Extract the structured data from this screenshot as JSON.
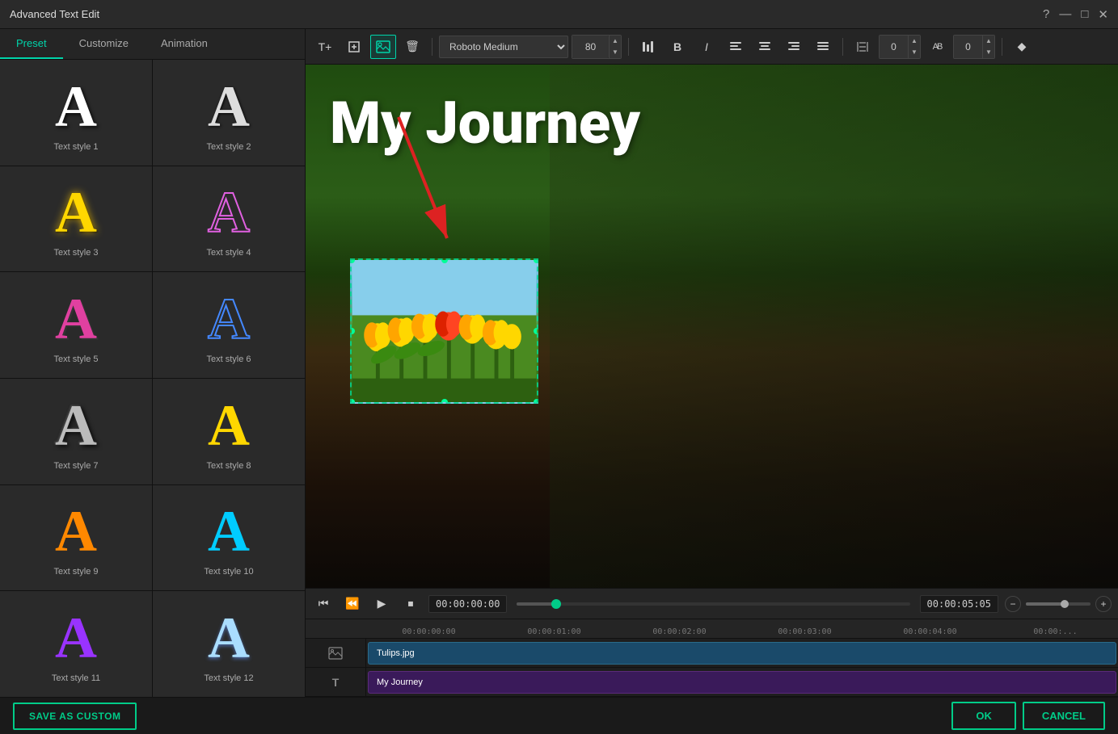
{
  "window": {
    "title": "Advanced Text Edit",
    "controls": [
      "?",
      "—",
      "□",
      "×"
    ]
  },
  "tabs": [
    {
      "label": "Preset",
      "active": true
    },
    {
      "label": "Customize",
      "active": false
    },
    {
      "label": "Animation",
      "active": false
    }
  ],
  "toolbar": {
    "font": "Roboto Medium",
    "font_size": "80",
    "spacing_label": "0",
    "kerning_label": "0",
    "buttons": [
      "T+",
      "⇔",
      "⊞",
      "🗑"
    ]
  },
  "text_styles": [
    {
      "id": 1,
      "label": "Text style 1"
    },
    {
      "id": 2,
      "label": "Text style 2"
    },
    {
      "id": 3,
      "label": "Text style 3"
    },
    {
      "id": 4,
      "label": "Text style 4"
    },
    {
      "id": 5,
      "label": "Text style 5"
    },
    {
      "id": 6,
      "label": "Text style 6"
    },
    {
      "id": 7,
      "label": "Text style 7"
    },
    {
      "id": 8,
      "label": "Text style 8"
    },
    {
      "id": 9,
      "label": "Text style 9"
    },
    {
      "id": 10,
      "label": "Text style 10"
    },
    {
      "id": 11,
      "label": "Text style 11"
    },
    {
      "id": 12,
      "label": "Text style 12"
    }
  ],
  "preview": {
    "title_text": "My Journey",
    "image_label": "Tulips.jpg"
  },
  "playback": {
    "current_time": "00:00:00:00",
    "total_time": "00:00:05:05"
  },
  "timeline": {
    "marks": [
      "00:00:00:00",
      "00:00:01:00",
      "00:00:02:00",
      "00:00:03:00",
      "00:00:04:00",
      "00:00:"
    ],
    "tracks": [
      {
        "icon": "🖼",
        "label": "Tulips.jpg",
        "type": "image"
      },
      {
        "icon": "T",
        "label": "My Journey",
        "type": "text"
      }
    ]
  },
  "buttons": {
    "save_custom": "SAVE AS CUSTOM",
    "ok": "OK",
    "cancel": "CANCEL"
  }
}
